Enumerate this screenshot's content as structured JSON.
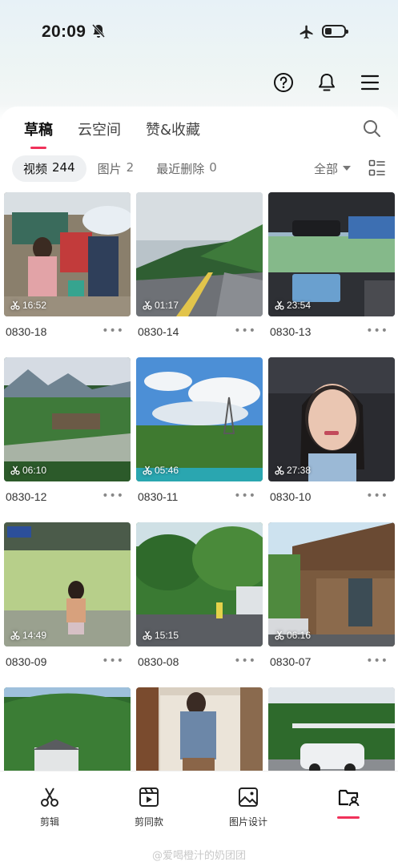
{
  "status": {
    "time": "20:09"
  },
  "tabs": [
    {
      "label": "草稿",
      "active": true
    },
    {
      "label": "云空间",
      "active": false
    },
    {
      "label": "赞&收藏",
      "active": false
    }
  ],
  "filters": [
    {
      "label": "视频",
      "count": "244",
      "active": true
    },
    {
      "label": "图片",
      "count": "2",
      "active": false
    },
    {
      "label": "最近删除",
      "count": "0",
      "active": false
    }
  ],
  "sort_label": "全部",
  "drafts": [
    {
      "name": "0830-18",
      "duration": "16:52",
      "scene": "street"
    },
    {
      "name": "0830-14",
      "duration": "01:17",
      "scene": "road"
    },
    {
      "name": "0830-13",
      "duration": "23:54",
      "scene": "car"
    },
    {
      "name": "0830-12",
      "duration": "06:10",
      "scene": "river"
    },
    {
      "name": "0830-11",
      "duration": "05:46",
      "scene": "sky"
    },
    {
      "name": "0830-10",
      "duration": "27:38",
      "scene": "selfie"
    },
    {
      "name": "0830-09",
      "duration": "14:49",
      "scene": "pool"
    },
    {
      "name": "0830-08",
      "duration": "15:15",
      "scene": "trees"
    },
    {
      "name": "0830-07",
      "duration": "06:16",
      "scene": "building"
    },
    {
      "name": "",
      "duration": "",
      "scene": "hill"
    },
    {
      "name": "",
      "duration": "",
      "scene": "mirror"
    },
    {
      "name": "",
      "duration": "",
      "scene": "parking"
    }
  ],
  "nav": [
    {
      "label": "剪辑",
      "icon": "scissors-icon"
    },
    {
      "label": "剪同款",
      "icon": "template-icon"
    },
    {
      "label": "图片设计",
      "icon": "image-design-icon"
    },
    {
      "label": "",
      "icon": "drafts-folder-icon",
      "active": true
    }
  ],
  "watermark": "@爱喝橙汁的奶团团",
  "colors": {
    "accent": "#f0325a",
    "chip_bg": "#eef0f2"
  }
}
